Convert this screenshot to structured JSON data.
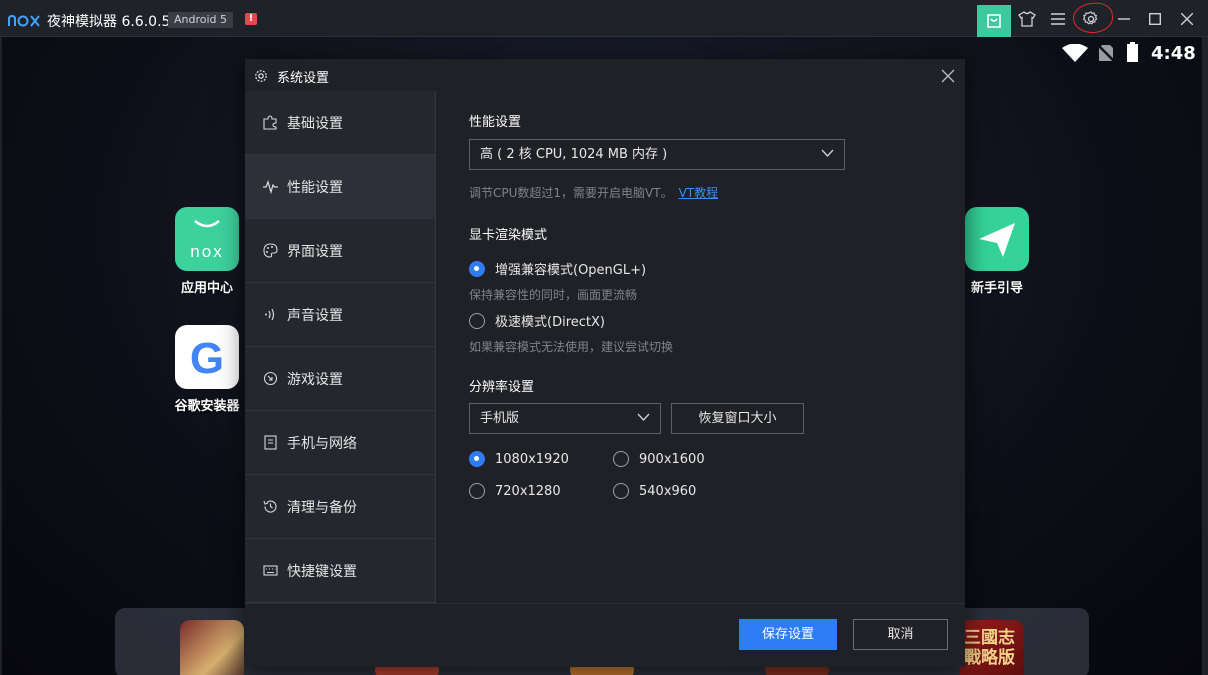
{
  "titlebar": {
    "app_title": "夜神模拟器 6.6.0.5",
    "android_badge": "Android 5",
    "alert_badge": "!",
    "icons": [
      "store-icon",
      "skin-icon",
      "menu-icon",
      "settings-icon",
      "minimize-icon",
      "maximize-icon",
      "close-icon"
    ],
    "accent_color": "#3dc99d"
  },
  "statusbar": {
    "time": "4:48"
  },
  "desktop": {
    "apps": [
      {
        "label": "应用中心",
        "tile_text": "nox"
      },
      {
        "label": "谷歌安装器",
        "tile_text": "G"
      },
      {
        "label": "新手引导"
      }
    ],
    "dock": {
      "game5_text": "三國志戰略版"
    }
  },
  "dialog": {
    "title": "系统设置",
    "sidebar": [
      {
        "label": "基础设置",
        "icon": "puzzle-icon"
      },
      {
        "label": "性能设置",
        "icon": "pulse-icon",
        "active": true
      },
      {
        "label": "界面设置",
        "icon": "palette-icon"
      },
      {
        "label": "声音设置",
        "icon": "speaker-icon"
      },
      {
        "label": "游戏设置",
        "icon": "gamepad-icon"
      },
      {
        "label": "手机与网络",
        "icon": "phone-icon"
      },
      {
        "label": "清理与备份",
        "icon": "history-icon"
      },
      {
        "label": "快捷键设置",
        "icon": "keyboard-icon"
      }
    ],
    "performance": {
      "title": "性能设置",
      "selected": "高 ( 2 核 CPU, 1024 MB 内存 )",
      "hint": "调节CPU数超过1，需要开启电脑VT。",
      "hint_link": "VT教程"
    },
    "graphics": {
      "title": "显卡渲染模式",
      "option1": "增强兼容模式(OpenGL+)",
      "option1_desc": "保持兼容性的同时，画面更流畅",
      "option2": "极速模式(DirectX)",
      "option2_desc": "如果兼容模式无法使用，建议尝试切换"
    },
    "resolution": {
      "title": "分辨率设置",
      "selected": "手机版",
      "restore_button": "恢复窗口大小",
      "options": [
        "1080x1920",
        "900x1600",
        "720x1280",
        "540x960"
      ],
      "checked": "1080x1920"
    },
    "footer": {
      "save": "保存设置",
      "cancel": "取消"
    },
    "primary_color": "#2f7df5"
  }
}
